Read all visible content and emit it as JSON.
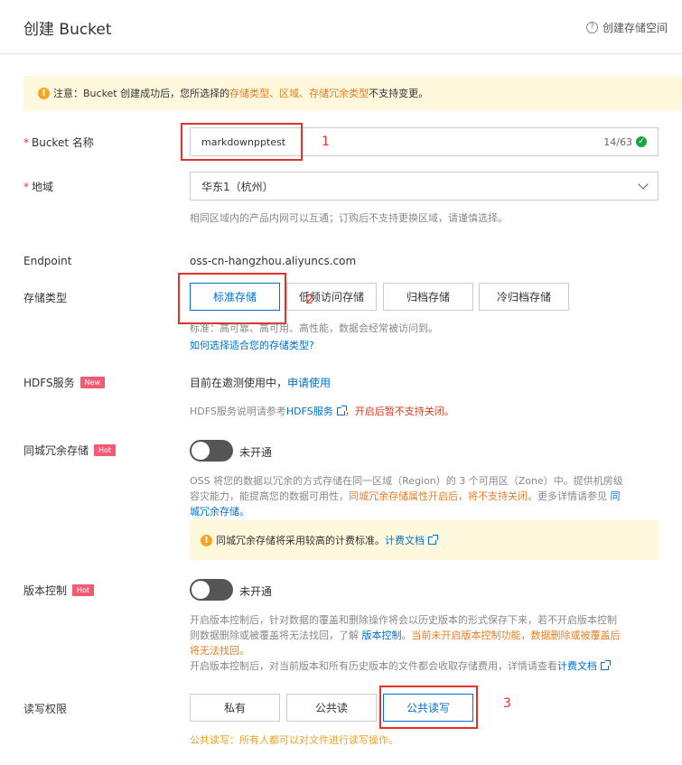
{
  "header": {
    "title": "创建 Bucket",
    "help_icon": "?",
    "help_link": "创建存储空间"
  },
  "notice": {
    "prefix": "注意：Bucket 创建成功后，您所选择的 ",
    "highlight1": "存储类型",
    "sep1": "、",
    "highlight2": "区域",
    "sep2": "、",
    "highlight3": "存储冗余类型",
    "suffix": " 不支持变更。"
  },
  "bucket_name": {
    "label": "Bucket 名称",
    "value": "markdownpptest",
    "count": "14/63",
    "annotation": "1"
  },
  "region": {
    "label": "地域",
    "value": "华东1（杭州）",
    "hint": "相同区域内的产品内网可以互通；订购后不支持更换区域，请谨慎选择。"
  },
  "endpoint": {
    "label": "Endpoint",
    "value": "oss-cn-hangzhou.aliyuncs.com"
  },
  "storage_type": {
    "label": "存储类型",
    "options": [
      "标准存储",
      "低频访问存储",
      "归档存储",
      "冷归档存储"
    ],
    "selected": "标准存储",
    "hint": "标准：高可靠、高可用、高性能，数据会经常被访问到。",
    "link": "如何选择适合您的存储类型?",
    "annotation": "2"
  },
  "hdfs": {
    "label": "HDFS服务",
    "badge": "New",
    "status": "目前在邀测使用中，",
    "apply_link": "申请使用",
    "desc_prefix": "HDFS服务说明请参考",
    "desc_link": "HDFS服务",
    "desc_warn": "，开启后暂不支持关闭。"
  },
  "zrs": {
    "label": "同城冗余存储",
    "badge": "Hot",
    "toggle_label": "未开通",
    "desc_line1": "OSS 将您的数据以冗余的方式存储在同一区域（Region）的 3 个可用区（Zone）中。提供机房级",
    "desc_line2a": "容灾能力，能提高您的数据可用性，",
    "desc_line2b": "同城冗余存储属性开启后，将不支持关闭。",
    "desc_line2c": "更多详情请参见 ",
    "desc_line2d": "同",
    "desc_line3": "城冗余存储。",
    "notice_text": "同城冗余存储将采用较高的计费标准。",
    "notice_link": "计费文档"
  },
  "versioning": {
    "label": "版本控制",
    "badge": "Hot",
    "toggle_label": "未开通",
    "line1": "开启版本控制后，针对数据的覆盖和删除操作将会以历史版本的形式保存下来，若不开启版本控制",
    "line2a": "则数据删除或被覆盖将无法找回，了解 ",
    "line2b": "版本控制",
    "line2c": "。",
    "line2d": "当前未开启版本控制功能，数据删除或被覆盖后",
    "line3": "将无法找回。",
    "line4": "开启版本控制后，对当前版本和所有历史版本的文件都会收取存储费用，详情请查看",
    "line4_link": "计费文档"
  },
  "acl": {
    "label": "读写权限",
    "options": [
      "私有",
      "公共读",
      "公共读写"
    ],
    "selected": "公共读写",
    "hint": "公共读写：所有人都可以对文件进行读写操作。",
    "annotation": "3"
  },
  "colors": {
    "accent": "#0070cc",
    "warning": "#e67e22",
    "danger": "#d9381e",
    "success": "#1ba345",
    "annotation": "#e0312b"
  }
}
